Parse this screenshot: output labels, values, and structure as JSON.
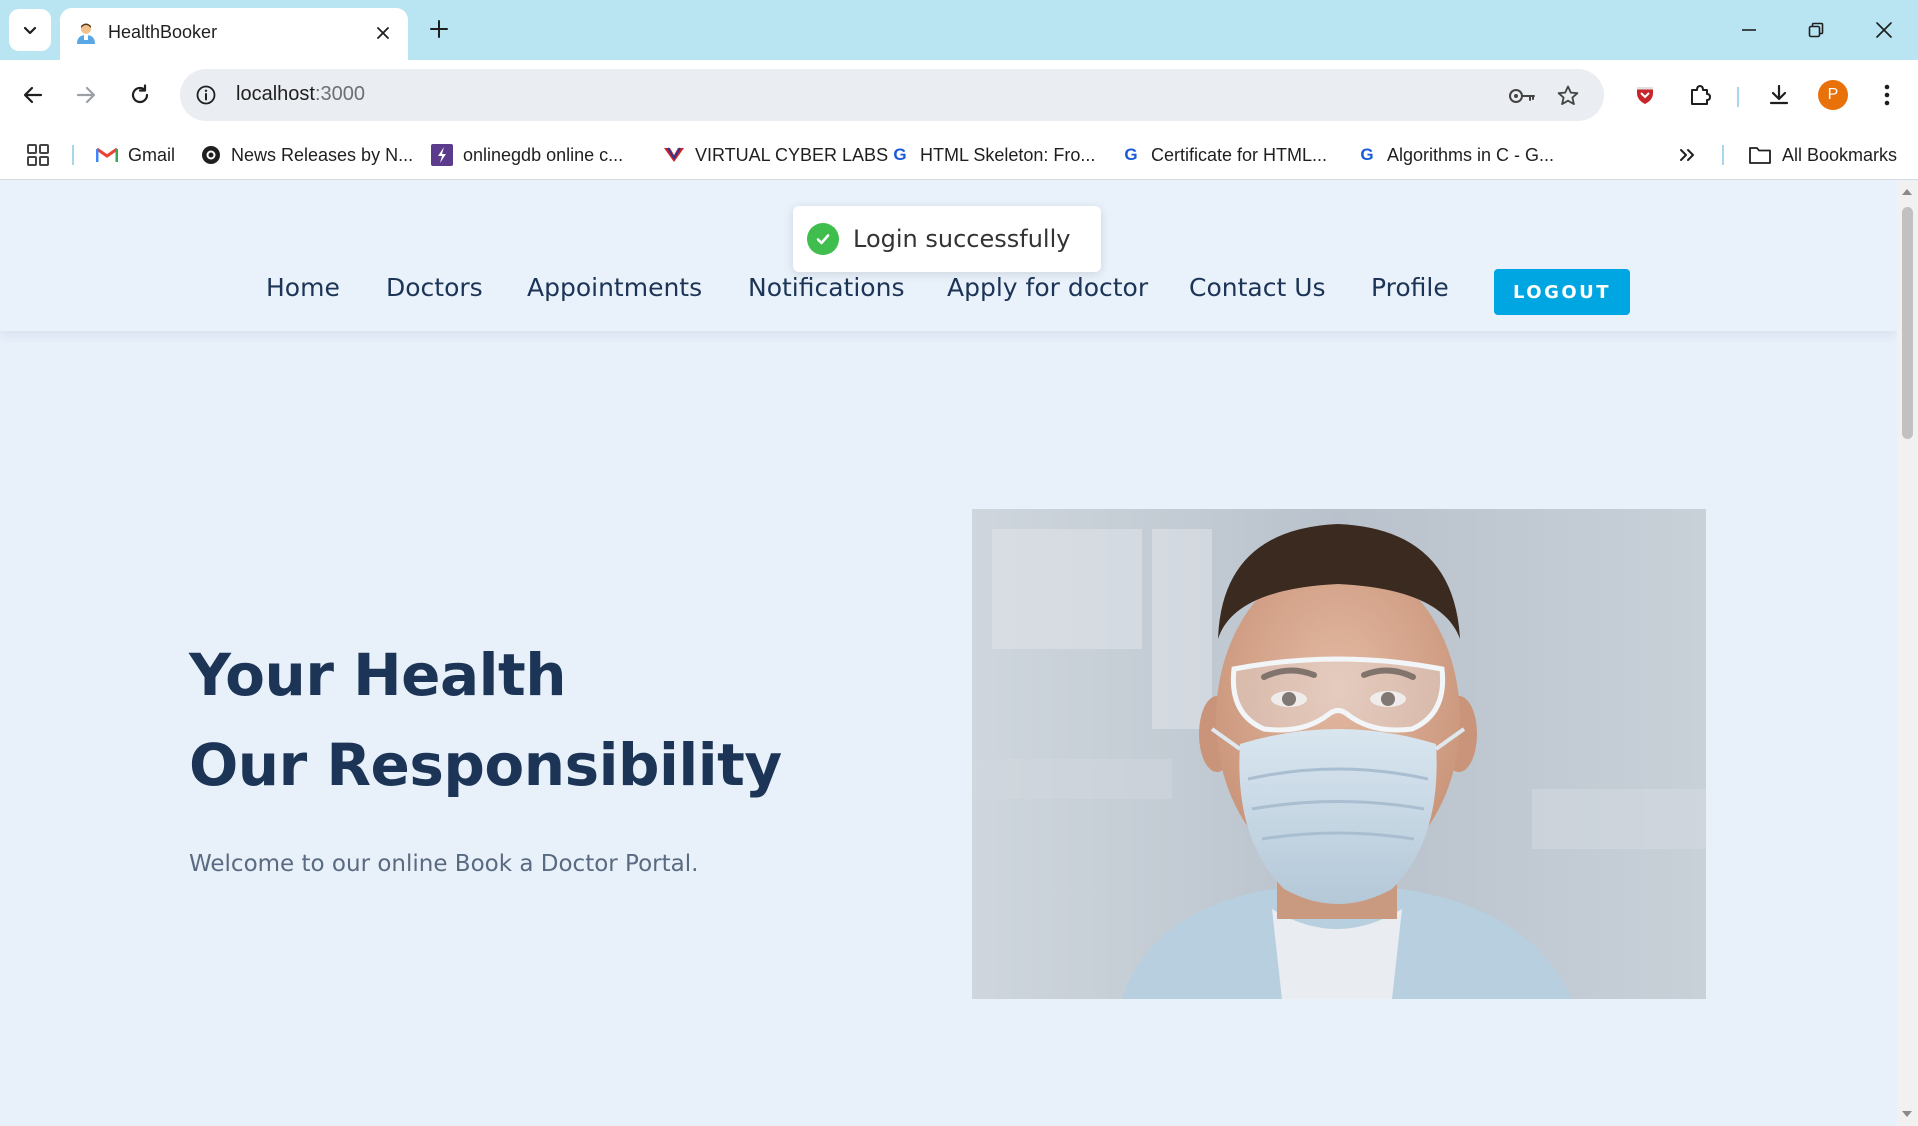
{
  "browser": {
    "tab_title": "HealthBooker",
    "url_host": "localhost",
    "url_path": ":3000",
    "profile_initial": "P",
    "accent_color": "#b9e5f2"
  },
  "bookmarks": [
    {
      "label": "Gmail",
      "icon": "gmail-icon"
    },
    {
      "label": "News Releases by N...",
      "icon": "news-icon"
    },
    {
      "label": "onlinegdb online c...",
      "icon": "onlinegdb-icon"
    },
    {
      "label": "VIRTUAL CYBER LABS",
      "icon": "vcl-icon"
    },
    {
      "label": "HTML Skeleton: Fro...",
      "icon": "google-icon"
    },
    {
      "label": "Certificate for HTML...",
      "icon": "google-icon"
    },
    {
      "label": "Algorithms in C - G...",
      "icon": "google-icon"
    }
  ],
  "all_bookmarks_label": "All Bookmarks",
  "toast": {
    "message": "Login successfully",
    "status_color": "#3fbd4d"
  },
  "nav": {
    "links": [
      "Home",
      "Doctors",
      "Appointments",
      "Notifications",
      "Apply for doctor",
      "Contact Us",
      "Profile"
    ],
    "logout_label": "LOGOUT",
    "button_color": "#00a6e1"
  },
  "hero": {
    "title_line1": "Your Health",
    "title_line2": "Our Responsibility",
    "subtitle": "Welcome to our online Book a Doctor Portal.",
    "image_alt": "doctor wearing surgical mask and safety glasses"
  }
}
